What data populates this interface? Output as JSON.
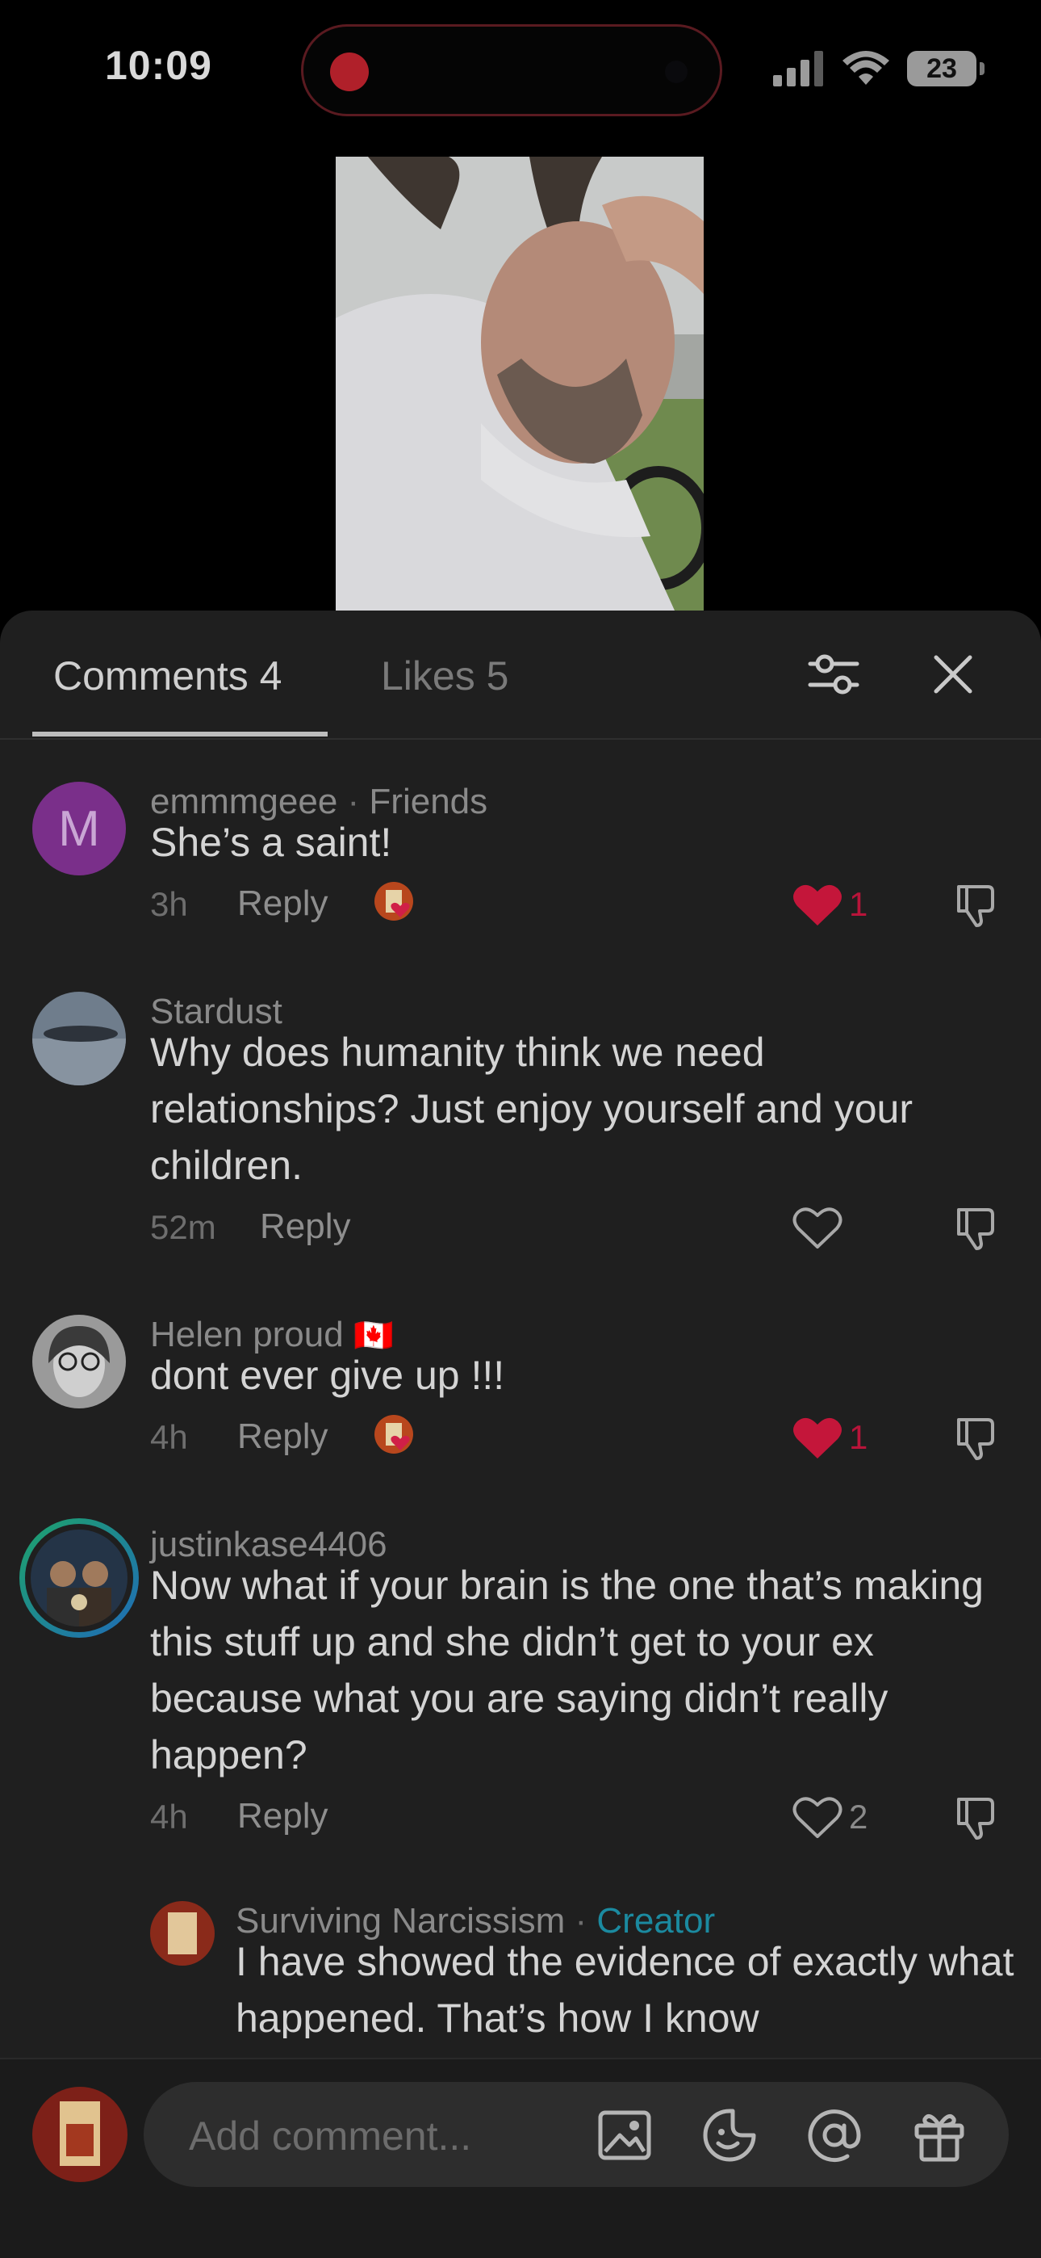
{
  "status": {
    "time": "10:09",
    "battery": "23"
  },
  "tabs": {
    "comments": "Comments 4",
    "likes": "Likes 5"
  },
  "comments": [
    {
      "avatar_letter": "M",
      "name": "emmmgeee",
      "badge": "Friends",
      "text": "She’s a saint!",
      "time": "3h",
      "reply": "Reply",
      "likes": "1",
      "liked": true
    },
    {
      "name": "Stardust",
      "text": "Why does humanity think we need relationships? Just enjoy yourself and your children.",
      "time": "52m",
      "reply": "Reply",
      "likes": "",
      "liked": false
    },
    {
      "name": "Helen proud",
      "flag": "🇨🇦",
      "text": "dont ever give up !!!",
      "time": "4h",
      "reply": "Reply",
      "likes": "1",
      "liked": true
    },
    {
      "name": "justinkase4406",
      "text": "Now what if your brain is the one that’s making this stuff up and she didn’t get to your ex because what you are saying didn’t really happen?",
      "time": "4h",
      "reply": "Reply",
      "likes": "2",
      "liked": false
    }
  ],
  "reply": {
    "name": "Surviving Narcissism",
    "badge": "Creator",
    "text": "I have showed the evidence of exactly what happened. That’s how I know"
  },
  "composer": {
    "placeholder": "Add comment..."
  },
  "colors": {
    "accent_red": "#c4163a",
    "creator": "#1b8aa0",
    "sheet_bg": "#1f1f1f"
  },
  "icons": [
    "signal-icon",
    "wifi-icon",
    "filter-icon",
    "close-icon",
    "heart-icon",
    "dislike-icon",
    "image-icon",
    "emoji-icon",
    "mention-icon",
    "gift-icon"
  ]
}
